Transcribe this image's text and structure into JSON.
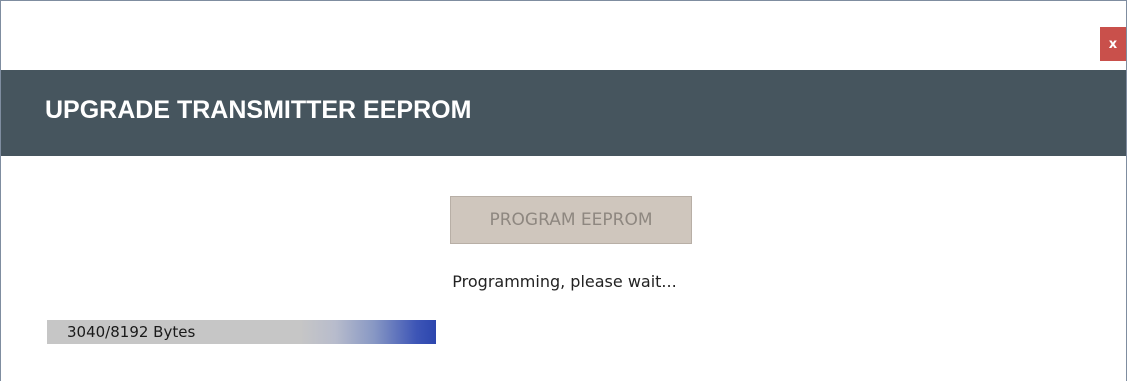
{
  "window": {
    "close_label": "x"
  },
  "header": {
    "title": "UPGRADE TRANSMITTER EEPROM"
  },
  "actions": {
    "program_label": "PROGRAM EEPROM"
  },
  "status": {
    "message": "Programming, please wait..."
  },
  "progress": {
    "label": "3040/8192 Bytes",
    "fraction": 0.3776
  },
  "colors": {
    "header_bg": "#46555e",
    "close_bg": "#c9504b",
    "button_disabled_bg": "#cfc6bd",
    "progress_accent": "#2c46ae"
  }
}
